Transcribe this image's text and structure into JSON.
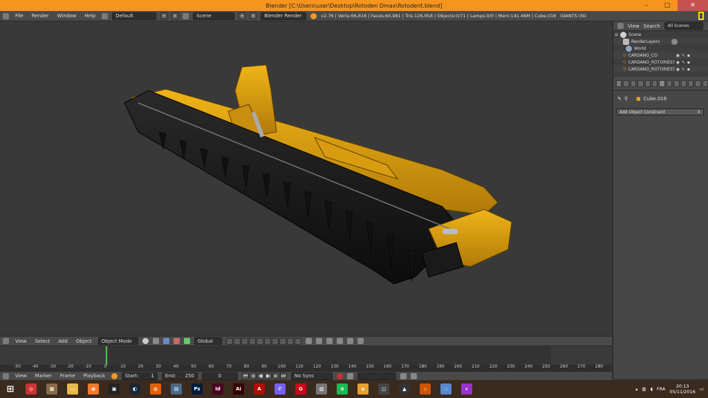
{
  "window": {
    "title": "Blender [C:\\Users\\user\\Desktop\\Rotoden Dmax\\Rotodent.blend]",
    "controls": [
      "–",
      "□",
      "✕"
    ]
  },
  "topbar": {
    "menus": [
      "File",
      "Render",
      "Window",
      "Help"
    ],
    "layout": "Default",
    "scene": "Scene",
    "engine": "Blender Render",
    "stats": "v2.76 | Verts:66,816 | Faces:60,981 | Tris:126,958 | Objects:0/71 | Lamps:0/0 | Mem:141.46M | Cube.016",
    "addon": "GIANTS I3D",
    "colors": {
      "accent": "#f7941d",
      "header": "#4a4a4a"
    }
  },
  "outliner": {
    "tabs": [
      "View",
      "Search",
      "All Scenes"
    ],
    "items": [
      {
        "label": "Scene",
        "icon": "scene-icon"
      },
      {
        "label": "RenderLayers",
        "icon": "renderlayers-icon"
      },
      {
        "label": "World",
        "icon": "world-icon"
      },
      {
        "label": "CARDANO_CO",
        "icon": "mesh-icon"
      },
      {
        "label": "CARDANO_ROTORIEST",
        "icon": "mesh-icon"
      },
      {
        "label": "CARDANO_ROTORIEST",
        "icon": "mesh-icon"
      }
    ]
  },
  "properties": {
    "object_name": "Cube.016",
    "constraint_menu": "Add Object Constraint"
  },
  "view3d_header": {
    "menus": [
      "View",
      "Select",
      "Add",
      "Object"
    ],
    "mode": "Object Mode",
    "orientation": "Global"
  },
  "timeline": {
    "ticks": [
      "-50",
      "-40",
      "-30",
      "-20",
      "-10",
      "0",
      "10",
      "20",
      "30",
      "40",
      "50",
      "60",
      "70",
      "80",
      "90",
      "100",
      "110",
      "120",
      "130",
      "140",
      "150",
      "160",
      "170",
      "180",
      "190",
      "200",
      "210",
      "220",
      "230",
      "240",
      "250",
      "260",
      "270",
      "280"
    ],
    "current_frame_label": "0",
    "menus": [
      "View",
      "Marker",
      "Frame",
      "Playback"
    ],
    "start_label": "Start:",
    "start_value": "1",
    "end_label": "End:",
    "end_value": "250",
    "frame_value": "0",
    "sync": "No Sync"
  },
  "taskbar": {
    "apps": [
      {
        "name": "windows-start-icon",
        "color": "#ffffff",
        "glyph": "⊞"
      },
      {
        "name": "search-icon",
        "color": "#cc3333",
        "glyph": "◎"
      },
      {
        "name": "store-icon",
        "color": "#8a6a4a",
        "glyph": "▦"
      },
      {
        "name": "file-explorer-icon",
        "color": "#e8b84a",
        "glyph": "▭"
      },
      {
        "name": "blender-icon",
        "color": "#f5792a",
        "glyph": "◉"
      },
      {
        "name": "game-icon",
        "color": "#222222",
        "glyph": "▣"
      },
      {
        "name": "steam-icon",
        "color": "#1b2838",
        "glyph": "◐"
      },
      {
        "name": "firefox-icon",
        "color": "#e66000",
        "glyph": "◍"
      },
      {
        "name": "app-icon",
        "color": "#4a6a8a",
        "glyph": "▤"
      },
      {
        "name": "photoshop-icon",
        "color": "#001e36",
        "glyph": "Ps"
      },
      {
        "name": "indesign-icon",
        "color": "#49021f",
        "glyph": "Id"
      },
      {
        "name": "illustrator-icon",
        "color": "#330000",
        "glyph": "Ai"
      },
      {
        "name": "acrobat-icon",
        "color": "#b30b00",
        "glyph": "A"
      },
      {
        "name": "viber-icon",
        "color": "#7360f2",
        "glyph": "✆"
      },
      {
        "name": "app-red-icon",
        "color": "#d0021b",
        "glyph": "G"
      },
      {
        "name": "app-gray-icon",
        "color": "#777777",
        "glyph": "▥"
      },
      {
        "name": "spotify-icon",
        "color": "#1db954",
        "glyph": "≋"
      },
      {
        "name": "app-orange-icon",
        "color": "#e8a030",
        "glyph": "◈"
      },
      {
        "name": "camera-icon",
        "color": "#444444",
        "glyph": "◫"
      },
      {
        "name": "app-triangle-icon",
        "color": "#333333",
        "glyph": "▲"
      },
      {
        "name": "app-flame-icon",
        "color": "#cc5500",
        "glyph": "♨"
      },
      {
        "name": "app-globe-icon",
        "color": "#5588cc",
        "glyph": "◌"
      },
      {
        "name": "app-purple-icon",
        "color": "#9933cc",
        "glyph": "⌕"
      }
    ],
    "clock_time": "20:13",
    "clock_date": "05/11/2016",
    "language": "FRA"
  }
}
